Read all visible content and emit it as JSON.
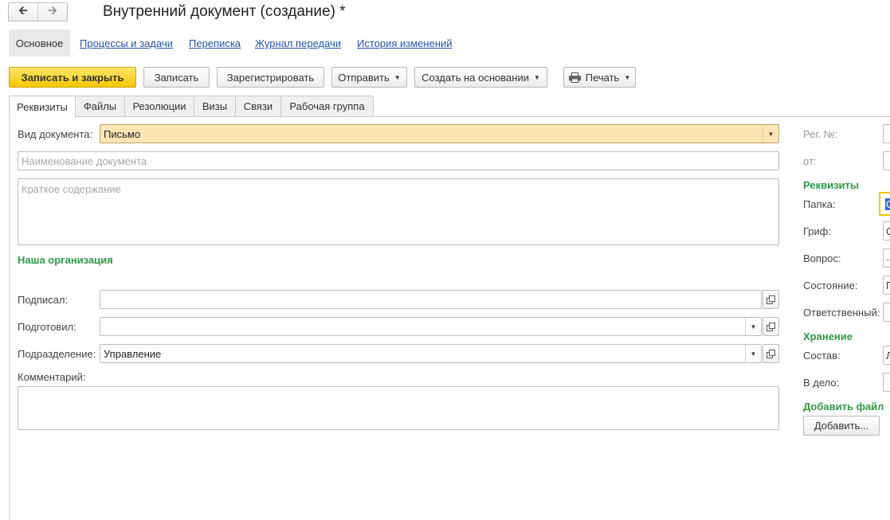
{
  "window": {
    "title": "Внутренний документ (создание) *"
  },
  "nav": {
    "back_icon": "arrow-left-icon",
    "forward_icon": "arrow-right-icon"
  },
  "sections": {
    "active": "Основное",
    "links": [
      "Процессы и задачи",
      "Переписка",
      "Журнал передачи",
      "История изменений"
    ]
  },
  "toolbar": {
    "save_close": "Записать и закрыть",
    "save": "Записать",
    "register": "Зарегистрировать",
    "send": "Отправить",
    "create_based": "Создать на основании",
    "print": "Печать"
  },
  "tabs": [
    "Реквизиты",
    "Файлы",
    "Резолюции",
    "Визы",
    "Связи",
    "Рабочая группа"
  ],
  "form": {
    "doc_type_label": "Вид документа:",
    "doc_type_value": "Письмо",
    "name_placeholder": "Наименование документа",
    "summary_placeholder": "Краткое содержание",
    "org_heading": "Наша организация",
    "signed_label": "Подписал:",
    "signed_value": "",
    "prepared_label": "Подготовил:",
    "prepared_value": "",
    "department_label": "Подразделение:",
    "department_value": "Управление",
    "comment_label": "Комментарий:"
  },
  "right_panel": {
    "reg_no_label": "Рег. №:",
    "from_label": "от:",
    "requisites_heading": "Реквизиты",
    "folder_label": "Папка:",
    "folder_value": "С",
    "stamp_label": "Гриф:",
    "stamp_value": "О",
    "question_label": "Вопрос:",
    "question_value": "...",
    "state_label": "Состояние:",
    "state_value": "П",
    "responsible_label": "Ответственный:",
    "storage_heading": "Хранение",
    "composition_label": "Состав:",
    "composition_value": "Л",
    "to_case_label": "В дело:",
    "add_file_heading": "Добавить файл",
    "add_button": "Добавить..."
  },
  "colors": {
    "primary_button": "#f5c800",
    "section_heading": "#2e9a46",
    "link": "#2255a4",
    "highlight_field": "#fde5b3"
  }
}
